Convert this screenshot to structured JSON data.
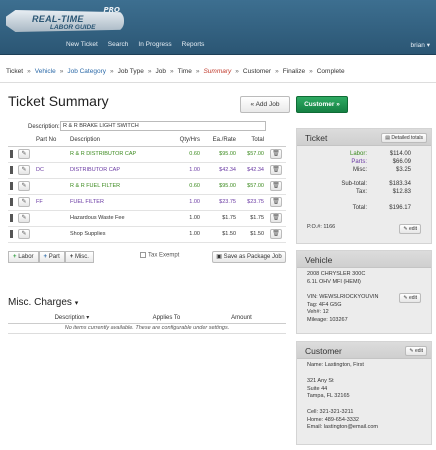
{
  "app": {
    "logo_pro": "PRO",
    "logo_line1": "REAL-TIME",
    "logo_line2": "LABOR GUIDE",
    "nav": [
      "New Ticket",
      "Search",
      "In Progress",
      "Reports"
    ],
    "user": "brian"
  },
  "breadcrumb": {
    "items": [
      "Ticket",
      "Vehicle",
      "Job Category",
      "Job Type",
      "Job",
      "Time",
      "Summary",
      "Customer",
      "Finalize",
      "Complete"
    ],
    "sep": "»"
  },
  "page": {
    "title": "Ticket Summary",
    "add_job": "« Add Job",
    "customer_btn": "Customer »"
  },
  "description": {
    "label": "Description:",
    "value": "R & R BRAKE LIGHT SWITCH"
  },
  "jobs": {
    "headers": [
      "Part No",
      "Description",
      "Qty/Hrs",
      "Ea./Rate",
      "Total"
    ],
    "rows": [
      {
        "type": "L",
        "part_no": "",
        "desc": "R & R DISTRIBUTOR CAP",
        "qty": "0.60",
        "rate": "$95.00",
        "total": "$57.00",
        "kind": "labor"
      },
      {
        "type": "P",
        "part_no": "DC",
        "desc": "DISTRIBUTOR CAP",
        "qty": "1.00",
        "rate": "$42.34",
        "total": "$42.34",
        "kind": "part"
      },
      {
        "type": "L",
        "part_no": "",
        "desc": "R & R FUEL FILTER",
        "qty": "0.60",
        "rate": "$95.00",
        "total": "$57.00",
        "kind": "labor"
      },
      {
        "type": "P",
        "part_no": "FF",
        "desc": "FUEL FILTER",
        "qty": "1.00",
        "rate": "$23.75",
        "total": "$23.75",
        "kind": "part"
      },
      {
        "type": "M",
        "part_no": "",
        "desc": "Hazardous Waste Fee",
        "qty": "1.00",
        "rate": "$1.75",
        "total": "$1.75",
        "kind": "misc"
      },
      {
        "type": "M",
        "part_no": "",
        "desc": "Shop Supplies",
        "qty": "1.00",
        "rate": "$1.50",
        "total": "$1.50",
        "kind": "misc"
      }
    ]
  },
  "actions": {
    "labor": "Labor",
    "part": "Part",
    "misc": "Misc.",
    "tax_exempt": "Tax Exempt",
    "save_package": "Save as Package Job"
  },
  "misc_charges": {
    "title": "Misc. Charges",
    "headers": [
      "Description",
      "Applies To",
      "Amount"
    ],
    "empty": "No items currently available. These are configurable under settings."
  },
  "ticket_panel": {
    "title": "Ticket",
    "detailed_totals": "Detailed totals",
    "labor_label": "Labor:",
    "labor_value": "$114.00",
    "parts_label": "Parts:",
    "parts_value": "$66.09",
    "misc_label": "Misc:",
    "misc_value": "$3.25",
    "subtotal_label": "Sub-total:",
    "subtotal_value": "$183.34",
    "tax_label": "Tax:",
    "tax_value": "$12.83",
    "total_label": "Total:",
    "total_value": "$196.17",
    "po": "P.O.#: 1166",
    "edit": "edit"
  },
  "vehicle_panel": {
    "title": "Vehicle",
    "lines": [
      "2008 CHRYSLER 300C",
      "6.1L OHV MFI (HEMI)"
    ],
    "details": [
      "VIN: WEWSLRIOCKYOUVIN",
      "Tag: 4F4 G5G",
      "Veh#: 12",
      "Mileage: 103267"
    ],
    "edit": "edit"
  },
  "customer_panel": {
    "title": "Customer",
    "name": "Name: Lastington, First",
    "address": [
      "321 Any St",
      "Suite 44",
      "Tampa, FL 32165"
    ],
    "contact": [
      "Cell: 321-321-3211",
      "Home: 489-654-3332",
      "Email: lastington@email.com"
    ],
    "edit": "edit"
  },
  "colors": {
    "topbar": "#2f5f80",
    "labor": "#3b8a1e",
    "part": "#6a3aa3",
    "accent_green": "#1f9a52",
    "current_crumb": "#c0392b"
  }
}
